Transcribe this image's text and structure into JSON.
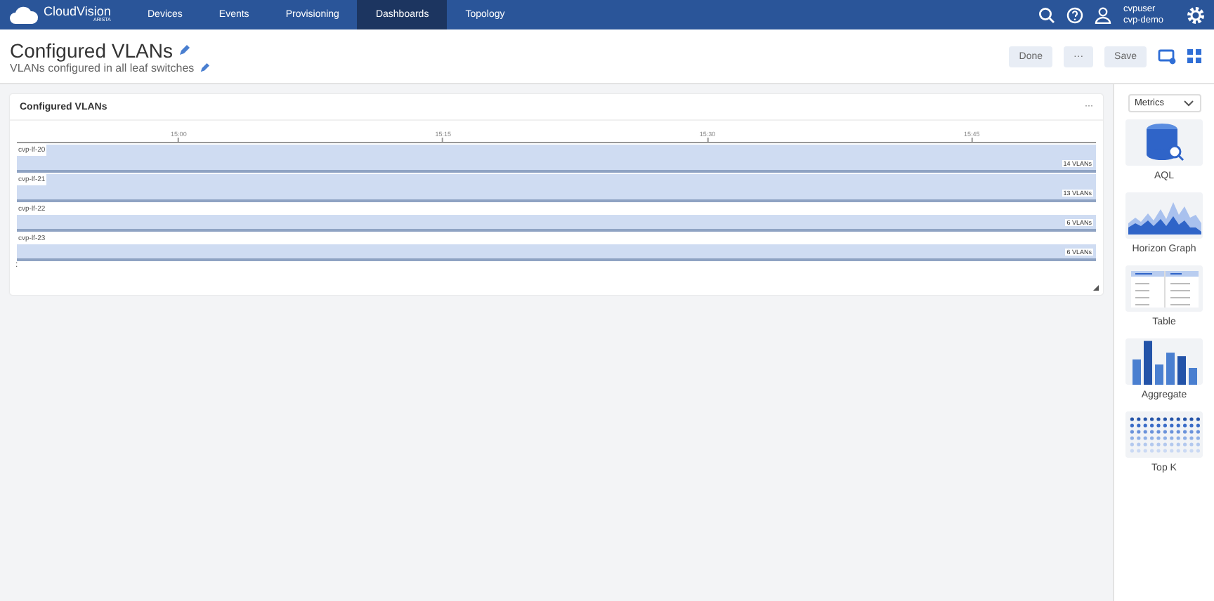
{
  "nav": {
    "brand": "CloudVision",
    "brand_sub": "ARISTA",
    "items": [
      {
        "label": "Devices",
        "selected": false
      },
      {
        "label": "Events",
        "selected": false
      },
      {
        "label": "Provisioning",
        "selected": false
      },
      {
        "label": "Dashboards",
        "selected": true
      },
      {
        "label": "Topology",
        "selected": false
      }
    ],
    "user": "cvpuser",
    "tenant": "cvp-demo"
  },
  "header": {
    "title": "Configured VLANs",
    "subtitle": "VLANs configured in all leaf switches",
    "buttons": [
      "Done",
      "···",
      "Save"
    ]
  },
  "widget": {
    "title": "Configured VLANs",
    "menu": "···",
    "ticks": [
      "15:00",
      "15:15",
      "15:30",
      "15:45"
    ],
    "rows": [
      {
        "name": "cvp-lf-20",
        "kind": "full",
        "reading": "14 VLANs"
      },
      {
        "name": "cvp-lf-21",
        "kind": "full",
        "reading": "13 VLANs"
      },
      {
        "name": "cvp-lf-22",
        "kind": "half",
        "reading": "6 VLANs"
      },
      {
        "name": "cvp-lf-23",
        "kind": "half",
        "reading": "6 VLANs"
      }
    ],
    "footer_mark": ":"
  },
  "sidebar": {
    "dropdown": "Metrics",
    "widgets": [
      {
        "kind": "aql",
        "label": "AQL"
      },
      {
        "kind": "horizon",
        "label": "Horizon Graph"
      },
      {
        "kind": "table",
        "label": "Table"
      },
      {
        "kind": "aggregate",
        "label": "Aggregate"
      },
      {
        "kind": "topk",
        "label": "Top K"
      }
    ]
  }
}
